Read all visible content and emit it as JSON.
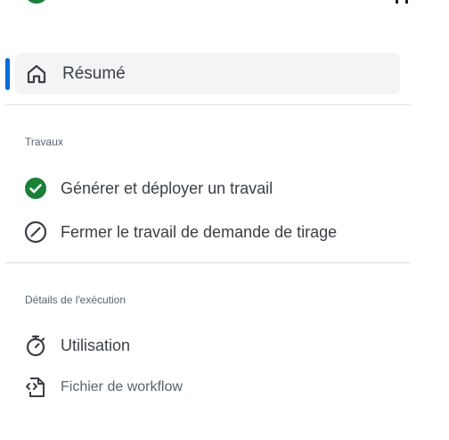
{
  "nav": {
    "summary": {
      "label": "Résumé",
      "icon": "home-icon",
      "active": true
    },
    "jobs_section": {
      "heading": "Travaux",
      "items": [
        {
          "label": "Générer et déployer un travail",
          "icon": "check-circle-icon",
          "status": "success"
        },
        {
          "label": "Fermer le travail de demande de tirage",
          "icon": "skipped-circle-icon",
          "status": "skipped"
        }
      ]
    },
    "run_details_section": {
      "heading": "Détails de l'exécution",
      "items": [
        {
          "label": "Utilisation",
          "icon": "stopwatch-icon"
        },
        {
          "label": "Fichier de workflow",
          "icon": "file-code-icon"
        }
      ]
    }
  },
  "colors": {
    "accent": "#0969da",
    "success": "#1a7f37",
    "active_background": "#f3f4f6",
    "divider": "#d8dee4"
  }
}
